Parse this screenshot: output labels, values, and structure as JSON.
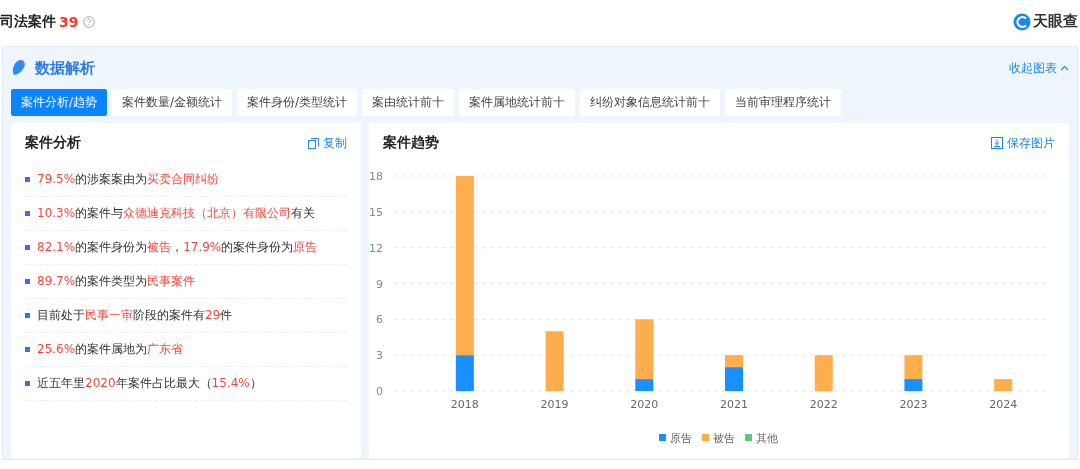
{
  "header": {
    "title": "司法案件",
    "count": "39",
    "logo": "天眼查"
  },
  "panel": {
    "title": "数据解析",
    "collapse": "收起图表"
  },
  "tabs": [
    {
      "label": "案件分析/趋势",
      "selected": true
    },
    {
      "label": "案件数量/金额统计",
      "selected": false
    },
    {
      "label": "案件身份/类型统计",
      "selected": false
    },
    {
      "label": "案由统计前十",
      "selected": false
    },
    {
      "label": "案件属地统计前十",
      "selected": false
    },
    {
      "label": "纠纷对象信息统计前十",
      "selected": false
    },
    {
      "label": "当前审理程序统计",
      "selected": false
    }
  ],
  "analysis": {
    "title": "案件分析",
    "copy": "复制",
    "items": [
      {
        "segments": [
          {
            "text": "79.5%",
            "highlight": true
          },
          {
            "text": "的涉案案由为",
            "highlight": false
          },
          {
            "text": "买卖合同纠纷",
            "highlight": true
          }
        ]
      },
      {
        "segments": [
          {
            "text": "10.3%",
            "highlight": true
          },
          {
            "text": "的案件与",
            "highlight": false
          },
          {
            "text": "众德迪克科技（北京）有限公司",
            "highlight": true
          },
          {
            "text": "有关",
            "highlight": false
          }
        ]
      },
      {
        "segments": [
          {
            "text": "82.1%",
            "highlight": true
          },
          {
            "text": "的案件身份为",
            "highlight": false
          },
          {
            "text": "被告",
            "highlight": true
          },
          {
            "text": "，",
            "highlight": false
          },
          {
            "text": "17.9%",
            "highlight": true
          },
          {
            "text": "的案件身份为",
            "highlight": false
          },
          {
            "text": "原告",
            "highlight": true
          }
        ]
      },
      {
        "segments": [
          {
            "text": "89.7%",
            "highlight": true
          },
          {
            "text": "的案件类型为",
            "highlight": false
          },
          {
            "text": "民事案件",
            "highlight": true
          }
        ]
      },
      {
        "segments": [
          {
            "text": "目前处于",
            "highlight": false
          },
          {
            "text": "民事一审",
            "highlight": true
          },
          {
            "text": "阶段的案件有",
            "highlight": false
          },
          {
            "text": "29",
            "highlight": true
          },
          {
            "text": "件",
            "highlight": false
          }
        ]
      },
      {
        "segments": [
          {
            "text": "25.6%",
            "highlight": true
          },
          {
            "text": "的案件属地为",
            "highlight": false
          },
          {
            "text": "广东省",
            "highlight": true
          }
        ]
      },
      {
        "segments": [
          {
            "text": "近五年里",
            "highlight": false
          },
          {
            "text": "2020",
            "highlight": true
          },
          {
            "text": "年案件占比最大（",
            "highlight": false
          },
          {
            "text": "15.4%",
            "highlight": true
          },
          {
            "text": "）",
            "highlight": false
          }
        ]
      }
    ]
  },
  "trend": {
    "title": "案件趋势",
    "save": "保存图片",
    "chart_data": {
      "type": "bar",
      "stacked": true,
      "categories": [
        "2018",
        "2019",
        "2020",
        "2021",
        "2022",
        "2023",
        "2024"
      ],
      "series": [
        {
          "name": "原告",
          "color": "#1890ff",
          "values": [
            3,
            0,
            1,
            2,
            0,
            1,
            0
          ]
        },
        {
          "name": "被告",
          "color": "#ffad4d",
          "values": [
            15,
            5,
            5,
            1,
            3,
            2,
            1
          ]
        },
        {
          "name": "其他",
          "color": "#5cc77a",
          "values": [
            0,
            0,
            0,
            0,
            0,
            0,
            0
          ]
        }
      ],
      "ylim": [
        0,
        18
      ],
      "yticks": [
        0,
        3,
        6,
        9,
        12,
        15,
        18
      ],
      "grid": true,
      "legend": true
    }
  }
}
